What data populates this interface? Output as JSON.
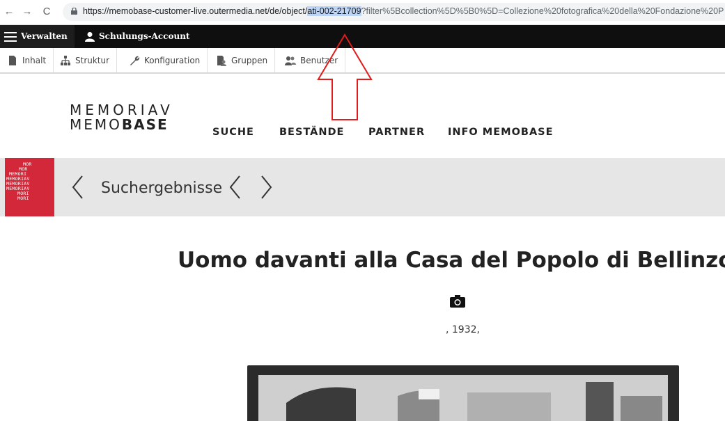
{
  "browser": {
    "back_glyph": "←",
    "forward_glyph": "→",
    "reload_glyph": "C",
    "url_prefix": "https://memobase-customer-live.outermedia.net/de/object/",
    "url_selected": "ati-002-21709",
    "url_suffix": "?filter%5Bcollection%5D%5B0%5D=Collezione%20fotografica%20della%20Fondazione%20P"
  },
  "admin_toolbar": {
    "manage_label": "Verwalten",
    "account_label": "Schulungs-Account"
  },
  "tray": {
    "items": [
      {
        "label": "Inhalt",
        "icon": "file-icon"
      },
      {
        "label": "Struktur",
        "icon": "sitemap-icon"
      },
      {
        "label": "Konfiguration",
        "icon": "wrench-icon"
      },
      {
        "label": "Gruppen",
        "icon": "group-icon"
      },
      {
        "label": "Benutzer",
        "icon": "users-icon"
      }
    ]
  },
  "site": {
    "logo_line1": "MEMORIAV",
    "logo_line2_light": "MEMO",
    "logo_line2_bold": "BASE",
    "nav": [
      "SUCHE",
      "BESTÄNDE",
      "PARTNER",
      "INFO MEMOBASE"
    ]
  },
  "results": {
    "label": "Suchergebnisse",
    "badge_lines": [
      "MOR",
      "MOR",
      "MEMORI",
      "MEMORIAV",
      "MEMORIAV",
      "MEMORIAV",
      "MORI",
      "MORI"
    ]
  },
  "document": {
    "title": "Uomo davanti alla Casa del Popolo di Bellinzor",
    "media_icon": "camera-icon",
    "date_line": ", 1932,"
  },
  "colors": {
    "accent_red": "#d2283a",
    "admin_black": "#0f0f0f",
    "annotation_red": "#e21b1b"
  }
}
